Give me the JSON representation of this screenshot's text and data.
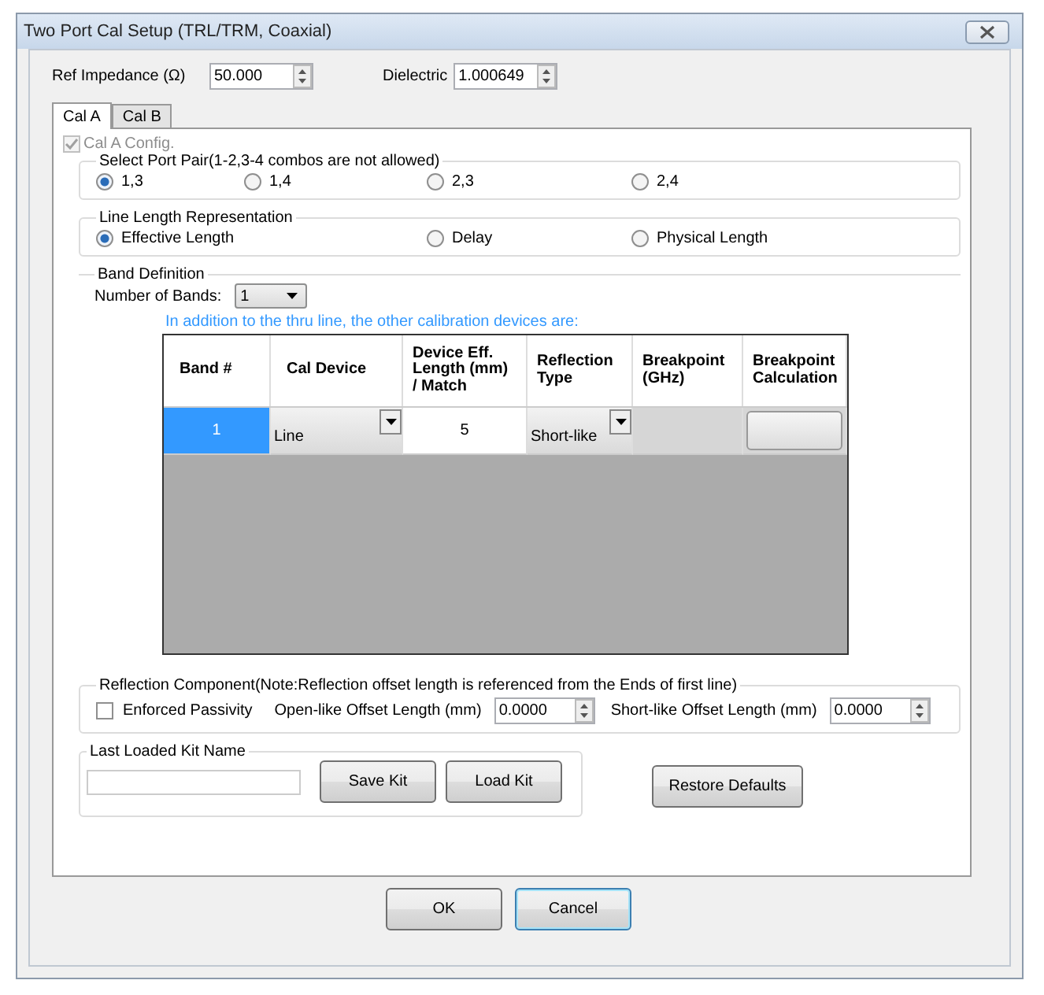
{
  "window": {
    "title": "Two Port Cal Setup (TRL/TRM, Coaxial)"
  },
  "ref_impedance": {
    "label": "Ref Impedance (Ω)",
    "value": "50.000"
  },
  "dielectric": {
    "label": "Dielectric",
    "value": "1.000649"
  },
  "tabs": [
    {
      "label": "Cal A",
      "selected": true
    },
    {
      "label": "Cal B",
      "selected": false
    }
  ],
  "cal_config": {
    "label": "Cal A Config.",
    "checked": true,
    "disabled": true
  },
  "port_pair": {
    "legend": "Select Port Pair(1-2,3-4 combos are not allowed)",
    "options": [
      {
        "label": "1,3",
        "selected": true
      },
      {
        "label": "1,4",
        "selected": false
      },
      {
        "label": "2,3",
        "selected": false
      },
      {
        "label": "2,4",
        "selected": false
      }
    ]
  },
  "line_length": {
    "legend": "Line Length Representation",
    "options": [
      {
        "label": "Effective Length",
        "selected": true
      },
      {
        "label": "Delay",
        "selected": false
      },
      {
        "label": "Physical Length",
        "selected": false
      }
    ]
  },
  "band_definition": {
    "legend": "Band Definition",
    "number_of_bands": {
      "label": "Number of Bands:",
      "value": "1"
    },
    "note": "In addition to the thru line, the other calibration devices are:",
    "table": {
      "columns": [
        "Band #",
        "Cal Device",
        "Device Eff. Length (mm) / Match",
        "Reflection Type",
        "Breakpoint (GHz)",
        "Breakpoint Calculation"
      ],
      "rows": [
        {
          "band": "1",
          "selected": true,
          "cal_device": "Line",
          "length": "5",
          "reflection_type": "Short-like"
        }
      ]
    }
  },
  "reflection": {
    "legend": "Reflection Component(Note:Reflection offset length is referenced from the Ends of first line)",
    "enforced_passivity": {
      "label": "Enforced Passivity",
      "checked": false
    },
    "open_offset": {
      "label": "Open-like Offset Length (mm)",
      "value": "0.0000"
    },
    "short_offset": {
      "label": "Short-like Offset Length (mm)",
      "value": "0.0000"
    }
  },
  "kit": {
    "legend": "Last Loaded Kit Name",
    "buttons": [
      "Save Kit",
      "Load Kit"
    ]
  },
  "restore_button": "Restore Defaults",
  "buttons": [
    {
      "label": "OK",
      "focused": false
    },
    {
      "label": "Cancel",
      "focused": true
    }
  ]
}
